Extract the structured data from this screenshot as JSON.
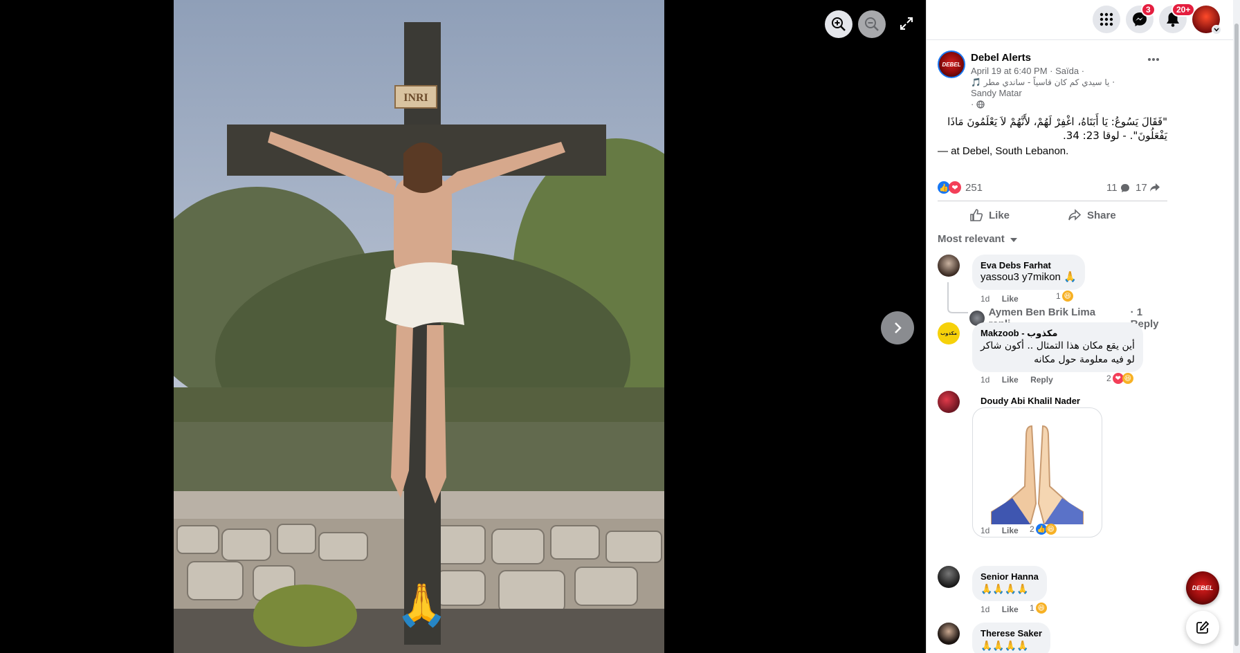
{
  "viewer": {
    "overlay_emoji": "🙏"
  },
  "topbar": {
    "messenger_badge": "3",
    "notifications_badge": "20+"
  },
  "post": {
    "author": "Debel Alerts",
    "meta_line1": "April 19 at 6:40 PM · Saïda ·",
    "meta_line2": "· يا سيدي كم كان قاسياً - ساندي مطر 🎵",
    "meta_line3": "Sandy Matar",
    "meta_line4": "·",
    "text": "\"فَقَالَ يَسُوعُ: يَا أَبَتَاهُ، اغْفِرْ لَهُمْ، لأَنَّهُمْ لاَ يَعْلَمُونَ مَاذَا يَفْعَلُونَ\". - لوقا 23: 34.",
    "location_prefix": "— at",
    "location": "Debel, South Lebanon.",
    "reaction_count": "251",
    "comment_count": "11",
    "share_count": "17",
    "like_label": "Like",
    "share_label": "Share",
    "sort_label": "Most relevant"
  },
  "comments": [
    {
      "name": "Eva Debs Farhat",
      "text": "yassou3 y7mikon 🙏",
      "time": "1d",
      "like": "Like",
      "reacts": "1"
    },
    {
      "name": "Makzoob - مكذوب",
      "text1": "أين يقع مكان هذا التمثال .. أكون شاكر",
      "text2": "لو فيه معلومة حول مكانه",
      "time": "1d",
      "like": "Like",
      "reply": "Reply",
      "reacts": "2"
    },
    {
      "name": "Doudy Abi Khalil Nader",
      "time": "1d",
      "like": "Like",
      "reacts": "2"
    },
    {
      "name": "Senior Hanna",
      "text": "🙏🙏🙏🙏",
      "time": "1d",
      "like": "Like",
      "reacts": "1"
    },
    {
      "name": "Therese Saker",
      "text": "🙏🙏🙏🙏"
    }
  ],
  "reply_line": {
    "text": "Aymen Ben Brik Lima repli...",
    "count": "· 1 Reply"
  },
  "colors": {
    "facebook_blue": "#1877f2",
    "love_red": "#f33e58",
    "badge_red": "#e41e3f"
  }
}
